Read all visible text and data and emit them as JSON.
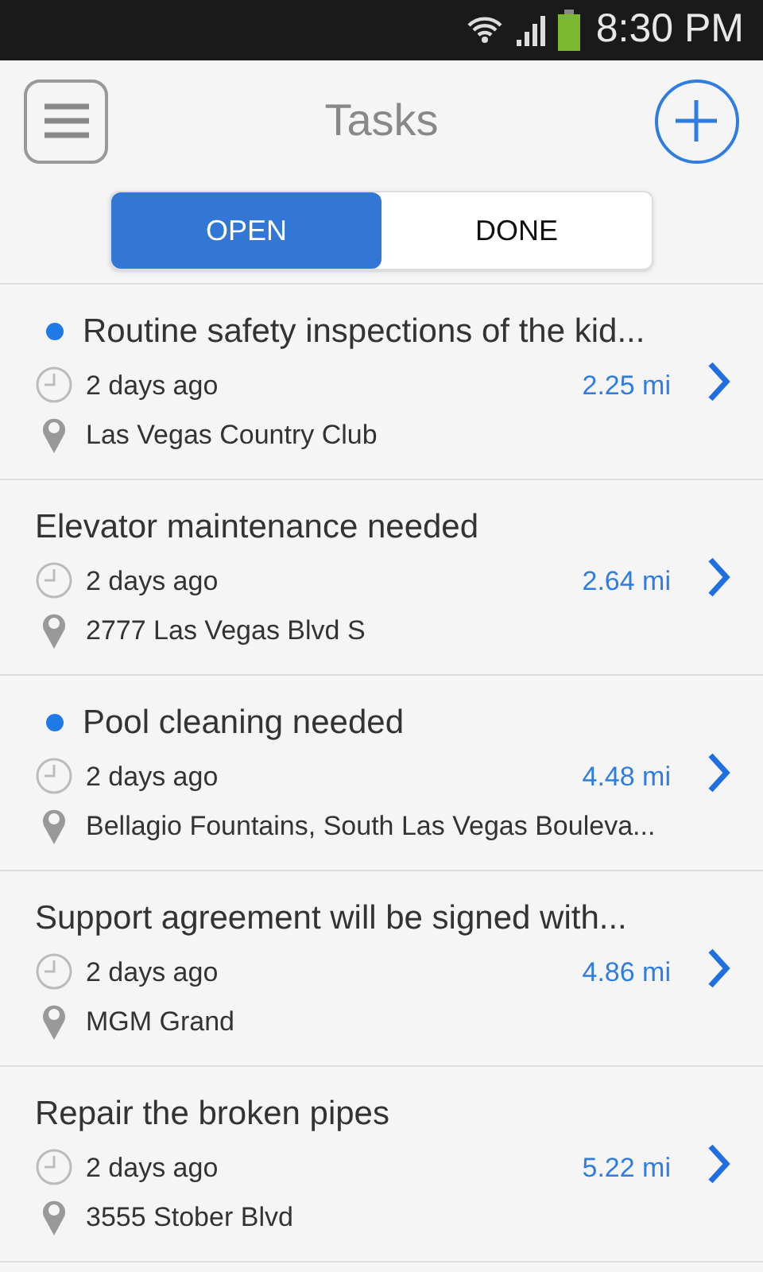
{
  "status_bar": {
    "time": "8:30 PM"
  },
  "header": {
    "title": "Tasks"
  },
  "tabs": [
    {
      "label": "OPEN",
      "selected": true
    },
    {
      "label": "DONE",
      "selected": false
    }
  ],
  "tasks": [
    {
      "title": "Routine safety inspections of the kid...",
      "unread": true,
      "time": "2 days ago",
      "distance": "2.25 mi",
      "location": "Las Vegas Country Club"
    },
    {
      "title": "Elevator maintenance needed",
      "unread": false,
      "time": "2 days ago",
      "distance": "2.64 mi",
      "location": "2777 Las Vegas Blvd S"
    },
    {
      "title": "Pool cleaning needed",
      "unread": true,
      "time": "2 days ago",
      "distance": "4.48 mi",
      "location": "Bellagio Fountains, South Las Vegas Bouleva..."
    },
    {
      "title": "Support agreement will be signed with...",
      "unread": false,
      "time": "2 days ago",
      "distance": "4.86 mi",
      "location": "MGM Grand"
    },
    {
      "title": "Repair the broken pipes",
      "unread": false,
      "time": "2 days ago",
      "distance": "5.22 mi",
      "location": "3555 Stober Blvd"
    }
  ]
}
